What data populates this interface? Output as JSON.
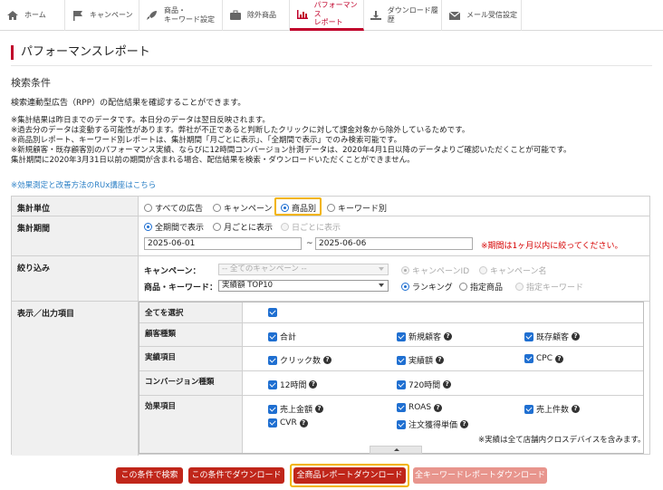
{
  "nav": {
    "items": [
      {
        "label": "ホーム",
        "icon": "home-icon"
      },
      {
        "label": "キャンペーン",
        "icon": "flag-icon"
      },
      {
        "label": "商品・\nキーワード設定",
        "icon": "rocket-icon"
      },
      {
        "label": "除外商品",
        "icon": "suitcase-icon"
      },
      {
        "label": "パフォーマンス\nレポート",
        "icon": "chart-icon",
        "active": true
      },
      {
        "label": "ダウンロード履歴",
        "icon": "download-icon"
      },
      {
        "label": "メール受信設定",
        "icon": "mail-icon"
      }
    ]
  },
  "page": {
    "title": "パフォーマンスレポート",
    "section_label": "検索条件",
    "description": "検索連動型広告（RPP）の配信結果を確認することができます。",
    "notes": [
      "※集計結果は昨日までのデータです。本日分のデータは翌日反映されます。",
      "※過去分のデータは変動する可能性があります。弊社が不正であると判断したクリックに対して課金対象から除外しているためです。",
      "※商品別レポート、キーワード別レポートは、集計期間「月ごとに表示」、「全期間で表示」でのみ検索可能です。",
      "※新規顧客・既存顧客別のパフォーマンス実績、ならびに12時間コンバージョン計測データは、2020年4月1日以降のデータよりご確認いただくことが可能です。",
      "集計期間に2020年3月31日以前の期間が含まれる場合、配信結果を検索・ダウンロードいただくことができません。"
    ],
    "help_link": "※効果測定と改善方法のRUx講座はこちら"
  },
  "form": {
    "unit": {
      "label": "集計単位",
      "options": [
        "すべての広告",
        "キャンペーン",
        "商品別",
        "キーワード別"
      ],
      "selected": "商品別"
    },
    "period": {
      "label": "集計期間",
      "options": [
        "全期間で表示",
        "月ごとに表示",
        "日ごとに表示"
      ],
      "selected": "全期間で表示",
      "start": "2025-06-01",
      "tilde": "~",
      "end": "2025-06-06",
      "warning": "※期間は1ヶ月以内に絞ってください。"
    },
    "filter": {
      "label": "絞り込み",
      "campaign_label": "キャンペーン：",
      "campaign_value": "-- 全てのキャンペーン --",
      "campaign_opts": [
        "キャンペーンID",
        "キャンペーン名"
      ],
      "product_label": "商品・キーワード：",
      "product_value": "実績額 TOP10",
      "product_opts": [
        "ランキング",
        "指定商品",
        "指定キーワード"
      ]
    },
    "output": {
      "label": "表示／出力項目",
      "rows": [
        {
          "label": "全てを選択",
          "items": [
            ""
          ]
        },
        {
          "label": "顧客種類",
          "items": [
            "合計",
            "新規顧客",
            "既存顧客"
          ]
        },
        {
          "label": "実績項目",
          "items": [
            "クリック数",
            "実績額",
            "CPC"
          ]
        },
        {
          "label": "コンバージョン種類",
          "items": [
            "12時間",
            "720時間"
          ]
        },
        {
          "label": "効果項目",
          "items": [
            "売上金額",
            "ROAS",
            "売上件数",
            "CVR",
            "注文獲得単価"
          ]
        }
      ],
      "note": "※実績は全て店舗内クロスデバイスを含みます。"
    }
  },
  "buttons": {
    "search": "この条件で検索",
    "download": "この条件でダウンロード",
    "all_product": "全商品レポートダウンロード",
    "all_keyword": "全キーワードレポートダウンロード"
  },
  "colors": {
    "accent": "#c0002a",
    "button": "#c0261a",
    "highlight": "#f2b400",
    "link": "#2a7fc6",
    "warning": "#d60000"
  }
}
